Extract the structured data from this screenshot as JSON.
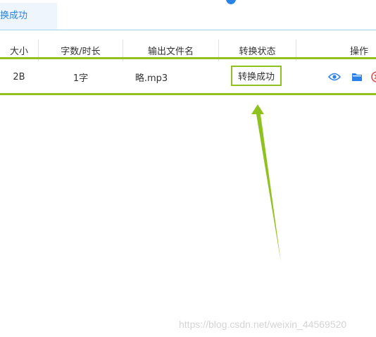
{
  "tabs": {
    "active_label": "转换成功"
  },
  "table": {
    "headers": [
      "大小",
      "字数/时长",
      "输出文件名",
      "转换状态",
      "操作"
    ],
    "rows": [
      {
        "size": "2B",
        "length": "1字",
        "output_name": "略.mp3",
        "status": "转换成功"
      }
    ]
  },
  "icons": {
    "view": "eye-icon",
    "folder": "folder-icon",
    "delete": "delete-icon"
  },
  "colors": {
    "accent": "#2b82e6",
    "highlight": "#8fc21f",
    "delete": "#e84a4a"
  },
  "watermark": "https://blog.csdn.net/weixin_44569520"
}
